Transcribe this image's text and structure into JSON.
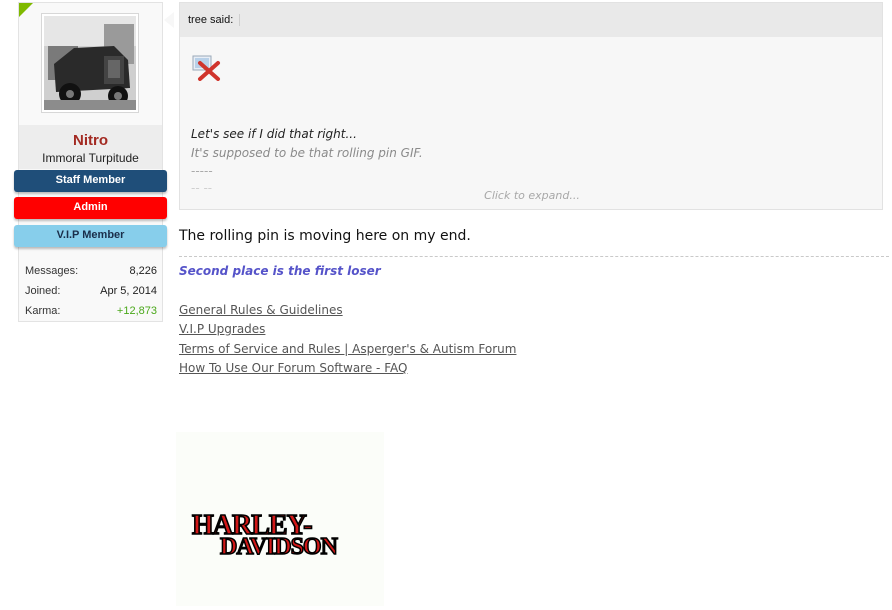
{
  "user": {
    "name": "Nitro",
    "title": "Immoral Turpitude",
    "banners": {
      "staff": "Staff Member",
      "admin": "Admin",
      "vip": "V.I.P Member"
    },
    "stats": [
      {
        "label": "Messages:",
        "value": "8,226"
      },
      {
        "label": "Joined:",
        "value": "Apr 5, 2014"
      },
      {
        "label": "Karma:",
        "value": "+12,873"
      }
    ]
  },
  "quote": {
    "author": "tree said:",
    "line1": "Let's see if I did that right...",
    "line2": "It's supposed to be that rolling pin GIF.",
    "line3": "-----",
    "faded": "-- --",
    "expand": "Click to expand..."
  },
  "post": {
    "text": "The rolling pin is moving here on my end."
  },
  "signature": {
    "motto": "Second place is the first loser",
    "links": [
      "General Rules & Guidelines",
      "V.I.P Upgrades",
      "Terms of Service and Rules | Asperger's & Autism Forum",
      "How To Use Our Forum Software - FAQ"
    ],
    "logo_line1": "HARLEY-",
    "logo_line2": "DAVIDSON"
  },
  "colors": {
    "staff": "#1f4e79",
    "admin": "#ff0000",
    "vip": "#87ceeb",
    "name": "#a32a22",
    "motto": "#5553c9",
    "karma": "#4aa81a",
    "corner": "#7fb900"
  }
}
